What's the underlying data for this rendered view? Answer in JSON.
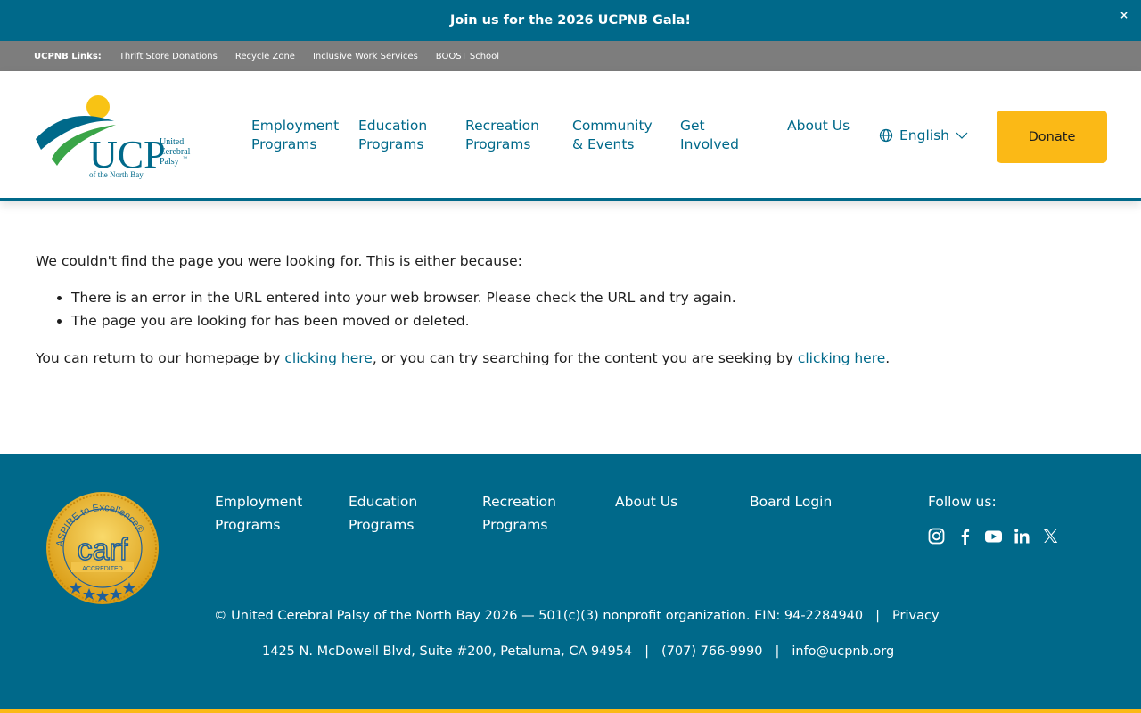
{
  "announcement": {
    "text": "Join us for the 2026 UCPNB Gala!",
    "close": "×"
  },
  "links_bar": {
    "label": "UCPNB Links:",
    "items": [
      "Thrift Store Donations",
      "Recycle Zone",
      "Inclusive Work Services",
      "BOOST School"
    ]
  },
  "logo": {
    "letters": "UCP",
    "line1": "United",
    "line2": "Cerebral",
    "line3": "Palsy",
    "tm": "™",
    "sub": "of the North Bay"
  },
  "nav": {
    "items": [
      {
        "line1": "Employment",
        "line2": "Programs"
      },
      {
        "line1": "Education",
        "line2": "Programs"
      },
      {
        "line1": "Recreation",
        "line2": "Programs"
      },
      {
        "line1": "Community",
        "line2": "& Events"
      },
      {
        "line1": "Get",
        "line2": "Involved"
      },
      {
        "line1": "About Us",
        "line2": ""
      }
    ],
    "language": "English",
    "donate": "Donate"
  },
  "main": {
    "intro": "We couldn't find the page you were looking for. This is either because:",
    "bullets": [
      "There is an error in the URL entered into your web browser. Please check the URL and try again.",
      "The page you are looking for has been moved or deleted."
    ],
    "return_prefix": "You can return to our homepage by ",
    "link1": "clicking here",
    "return_middle": ", or you can try searching for the content you are seeking by ",
    "link2": "clicking here",
    "return_suffix": "."
  },
  "footer": {
    "badge": {
      "ring": "ASPIRE to Excellence®",
      "word": "carf",
      "band": "ACCREDITED"
    },
    "links": [
      {
        "line1": "Employment",
        "line2": "Programs"
      },
      {
        "line1": "Education",
        "line2": "Programs"
      },
      {
        "line1": "Recreation",
        "line2": "Programs"
      },
      {
        "line1": "About Us",
        "line2": ""
      },
      {
        "line1": "Board Login",
        "line2": ""
      }
    ],
    "follow": "Follow us:",
    "social_icons": [
      "instagram-icon",
      "facebook-icon",
      "youtube-icon",
      "linkedin-icon",
      "x-icon"
    ],
    "copyright": "© United Cerebral Palsy of the North Bay 2026 — 501(c)(3) nonprofit organization. EIN: 94-2284940",
    "separator": "|",
    "privacy": "Privacy",
    "address": "1425 N. McDowell Blvd, Suite #200, Petaluma, CA 94954",
    "phone": "(707) 766-9990",
    "email": "info@ucpnb.org"
  },
  "colors": {
    "brand": "#00698a",
    "accent": "#fbb916",
    "links_bar": "#7d7d7d",
    "logo_green": "#3aa548",
    "logo_yellow": "#f8c314"
  }
}
